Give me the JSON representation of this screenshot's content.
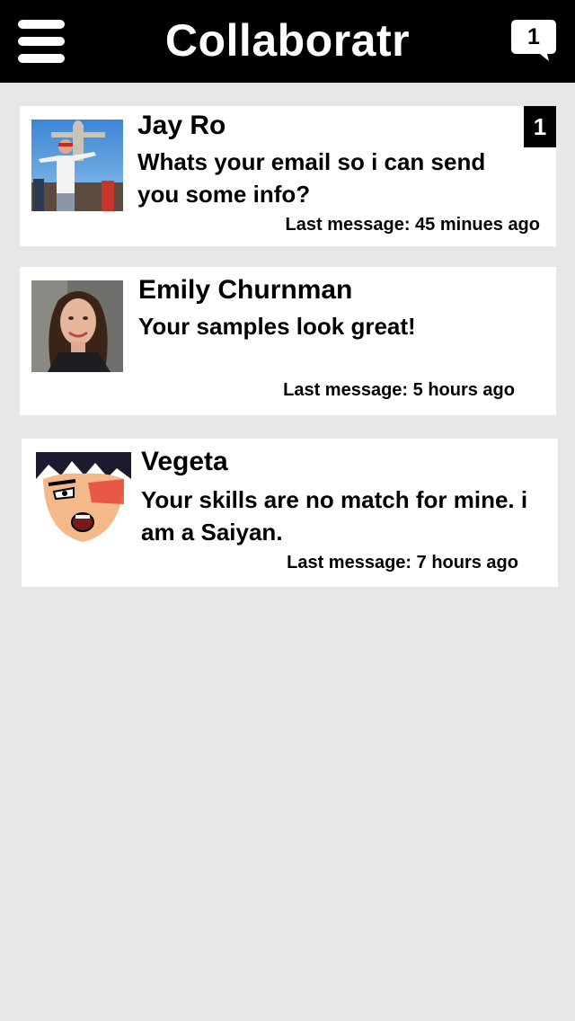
{
  "header": {
    "title": "Collaboratr",
    "notification_count": "1"
  },
  "conversations": [
    {
      "name": "Jay Ro",
      "message": "Whats your email so i can send you some info?",
      "last_message": "Last message: 45 minues ago",
      "unread": "1",
      "avatar": "photo-man-at-landmark"
    },
    {
      "name": "Emily Churnman",
      "message": "Your samples look great!",
      "last_message": "Last message: 5 hours ago",
      "avatar": "photo-woman-portrait"
    },
    {
      "name": "Vegeta",
      "message": "Your skills are no match for mine. i am a Saiyan.",
      "last_message": "Last message: 7 hours ago",
      "avatar": "cartoon-character-face"
    }
  ],
  "colors": {
    "header_bg": "#000000",
    "page_bg": "#e6e7e9",
    "card_bg": "#ffffff",
    "badge_bg": "#000000"
  }
}
